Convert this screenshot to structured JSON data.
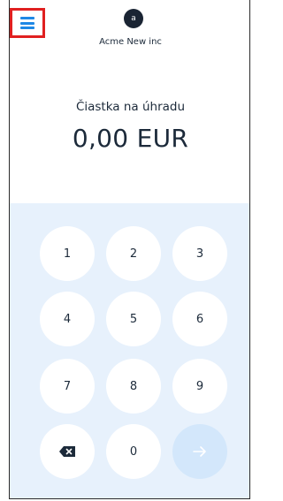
{
  "header": {
    "menu_icon": "hamburger-menu-icon",
    "avatar_letter": "a",
    "merchant_name": "Acme New inc"
  },
  "amount": {
    "label": "Čiastka na úhradu",
    "value": "0,00 EUR"
  },
  "keypad": {
    "keys": [
      "1",
      "2",
      "3",
      "4",
      "5",
      "6",
      "7",
      "8",
      "9"
    ],
    "zero": "0",
    "backspace_icon": "backspace-icon",
    "submit_icon": "arrow-right-icon",
    "submit_enabled": false
  },
  "colors": {
    "menu_highlight": "#e02020",
    "menu_icon": "#1e88e5",
    "keypad_bg": "#e7f1fc",
    "submit_disabled": "#d3e7fb",
    "avatar_bg": "#1a2433"
  }
}
